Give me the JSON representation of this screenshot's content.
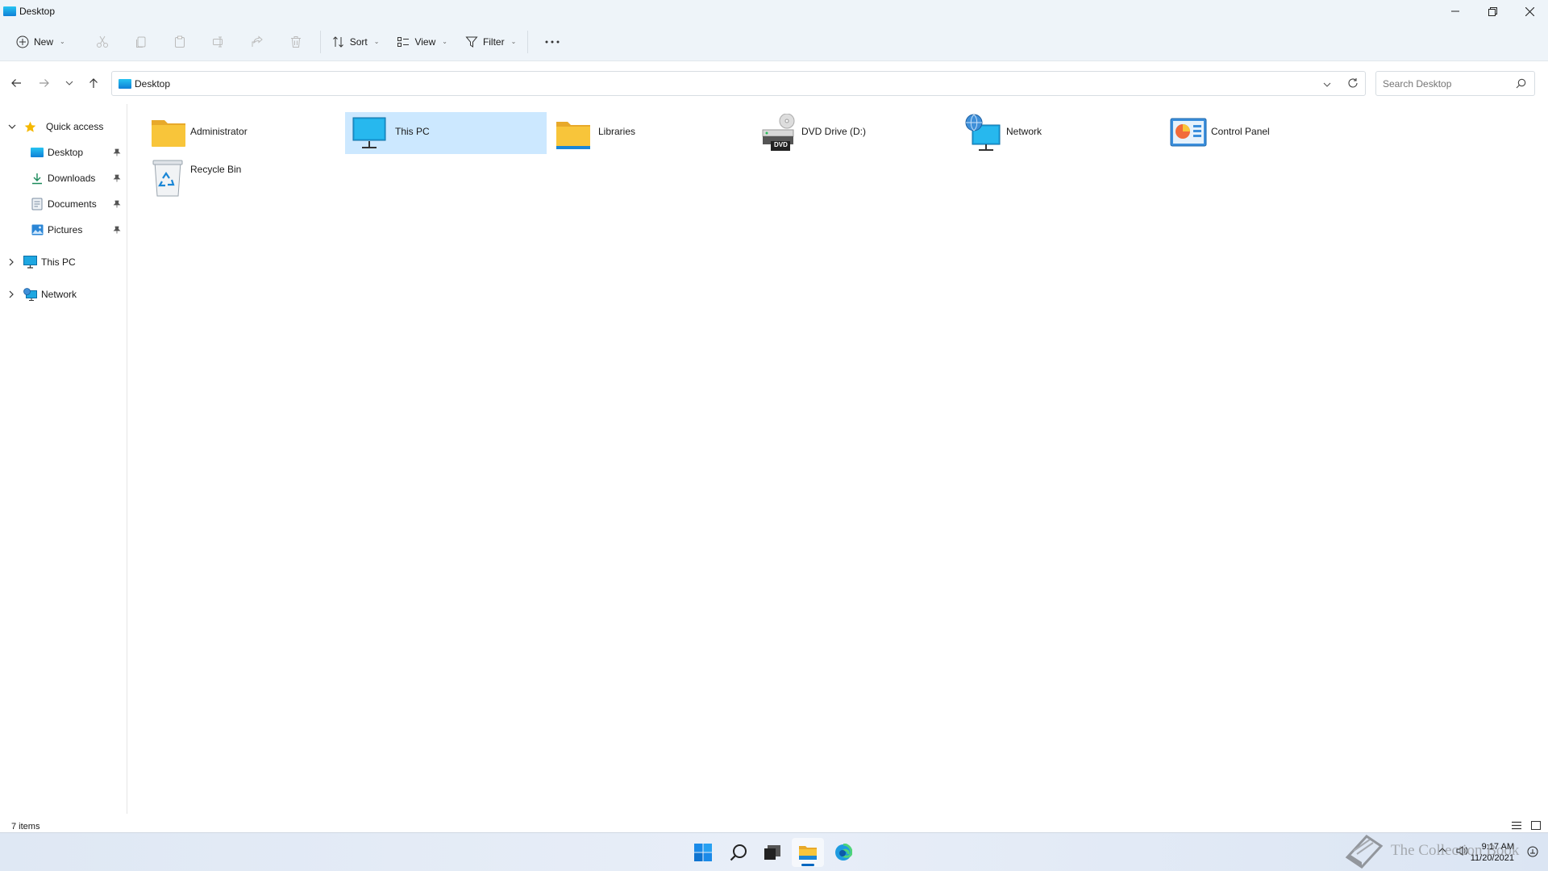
{
  "window": {
    "title": "Desktop",
    "icon": "desktop-folder-icon"
  },
  "window_controls": {
    "minimize": "minimize-icon",
    "restore": "restore-icon",
    "close": "close-icon"
  },
  "commandbar": {
    "new_label": "New",
    "sort_label": "Sort",
    "view_label": "View",
    "filter_label": "Filter",
    "icons": [
      "add-icon",
      "cut-icon",
      "copy-icon",
      "paste-icon",
      "rename-icon",
      "share-icon",
      "delete-icon",
      "more-options-icon"
    ]
  },
  "address": {
    "location": "Desktop"
  },
  "search": {
    "placeholder": "Search Desktop"
  },
  "navpane": {
    "quick_access": "Quick access",
    "items": [
      {
        "label": "Desktop",
        "icon": "desktop-folder-icon",
        "pinned": true
      },
      {
        "label": "Downloads",
        "icon": "downloads-icon",
        "pinned": true
      },
      {
        "label": "Documents",
        "icon": "documents-icon",
        "pinned": true
      },
      {
        "label": "Pictures",
        "icon": "pictures-icon",
        "pinned": true
      }
    ],
    "this_pc": "This PC",
    "network": "Network"
  },
  "content": {
    "items": [
      {
        "label": "Administrator",
        "icon": "folder-icon"
      },
      {
        "label": "This PC",
        "icon": "monitor-icon",
        "selected": true
      },
      {
        "label": "Libraries",
        "icon": "libraries-icon"
      },
      {
        "label": "DVD Drive (D:)",
        "icon": "dvd-drive-icon",
        "badge": "DVD"
      },
      {
        "label": "Network",
        "icon": "network-icon"
      },
      {
        "label": "Control Panel",
        "icon": "control-panel-icon"
      },
      {
        "label": "Recycle Bin",
        "icon": "recycle-bin-icon"
      }
    ]
  },
  "status": {
    "count": "7 items"
  },
  "taskbar": {
    "apps": [
      "start-icon",
      "search-icon",
      "task-view-icon",
      "file-explorer-icon",
      "edge-icon"
    ],
    "active": "file-explorer-icon",
    "time": "9:17 AM",
    "date": "11/20/2021"
  },
  "watermark": {
    "text": "The Collection Book"
  },
  "colors": {
    "accent": "#0067c0",
    "selection": "#cce8ff",
    "folder": "#f8c53a",
    "chrome": "#eef4f9"
  }
}
